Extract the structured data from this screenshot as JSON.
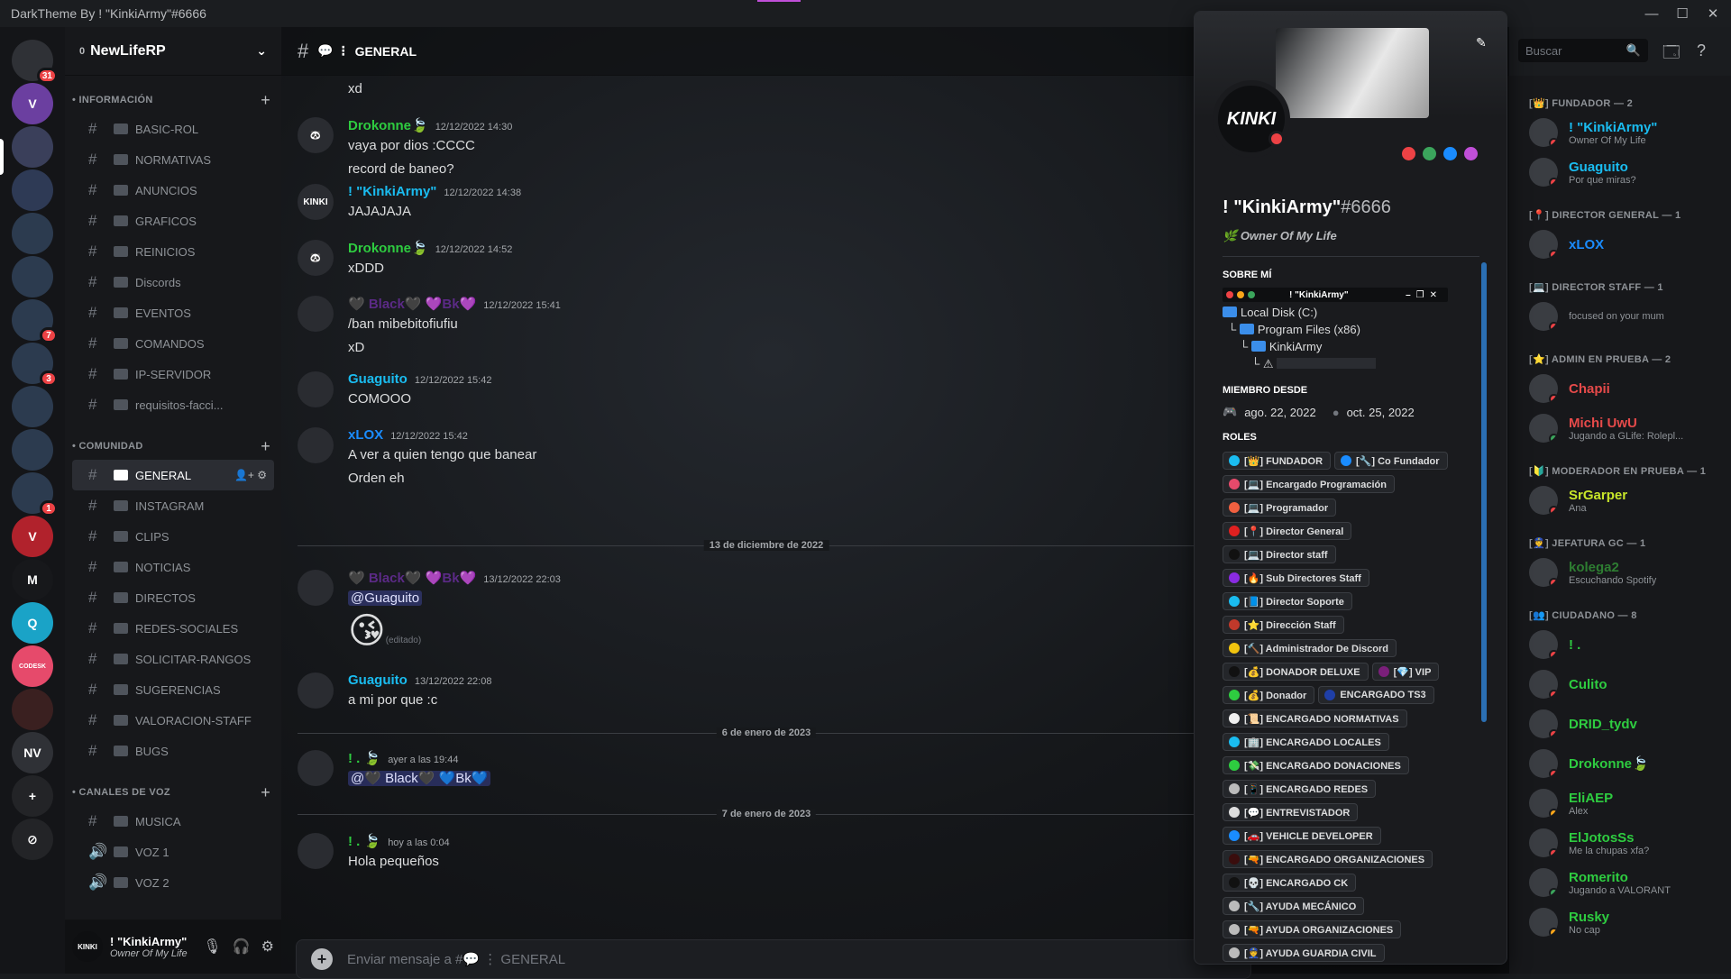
{
  "window": {
    "title": "DarkTheme By ! \"KinkiArmy\"#6666",
    "min": "—",
    "max": "☐",
    "close": "✕"
  },
  "servers": [
    {
      "label": "",
      "color": "#2f3136",
      "badge": "31"
    },
    {
      "label": "V",
      "color": "#6b3fa0",
      "badge": ""
    },
    {
      "label": "",
      "color": "#3a3f5a",
      "badge": ""
    },
    {
      "label": "",
      "color": "#2e3a55",
      "badge": ""
    },
    {
      "label": "",
      "color": "#2c3b4f",
      "badge": ""
    },
    {
      "label": "",
      "color": "#2c3b4f",
      "badge": ""
    },
    {
      "label": "",
      "color": "#2c3b4f",
      "badge": "7"
    },
    {
      "label": "",
      "color": "#2c3b4f",
      "badge": "3"
    },
    {
      "label": "",
      "color": "#2c3b4f",
      "badge": ""
    },
    {
      "label": "",
      "color": "#2c3b4f",
      "badge": ""
    },
    {
      "label": "",
      "color": "#2c3b4f",
      "badge": "1"
    },
    {
      "label": "V",
      "color": "#b1222c",
      "badge": ""
    },
    {
      "label": "M",
      "color": "#17181b",
      "badge": ""
    },
    {
      "label": "Q",
      "color": "#1aa3c7",
      "badge": ""
    },
    {
      "label": "CODESK",
      "color": "#e64a6b",
      "badge": ""
    },
    {
      "label": "",
      "color": "#3a2020",
      "badge": ""
    },
    {
      "label": "NV",
      "color": "#2f3136",
      "badge": ""
    },
    {
      "label": "+",
      "color": "#232427",
      "badge": ""
    },
    {
      "label": "⊘",
      "color": "#232427",
      "badge": ""
    }
  ],
  "guild": {
    "name": "NewLifeRP",
    "boost": "0"
  },
  "categories": {
    "info": "• INFORMACIÓN",
    "community": "• COMUNIDAD",
    "voice": "• CANALES DE VOZ"
  },
  "channels_info": [
    "BASIC-ROL",
    "NORMATIVAS",
    "ANUNCIOS",
    "GRAFICOS",
    "REINICIOS",
    "Discords",
    "EVENTOS",
    "COMANDOS",
    "IP-SERVIDOR",
    "requisitos-facci..."
  ],
  "channels_community": [
    "GENERAL",
    "INSTAGRAM",
    "CLIPS",
    "NOTICIAS",
    "DIRECTOS",
    "REDES-SOCIALES",
    "SOLICITAR-RANGOS",
    "SUGERENCIAS",
    "VALORACION-STAFF",
    "BUGS"
  ],
  "channels_voice": [
    "MUSICA",
    "VOZ 1",
    "VOZ 2"
  ],
  "user_panel": {
    "name": "! \"KinkiArmy\"",
    "status": "Owner Of My Life"
  },
  "chat": {
    "channel": "GENERAL",
    "placeholder": "Enviar mensaje a #💬 ⋮ GENERAL",
    "top_line": "xd",
    "messages": [
      {
        "author": "Drokonne🍃",
        "color": "#2ecc40",
        "time": "12/12/2022 14:30",
        "lines": [
          "vaya por dios :CCCC",
          "record de baneo?"
        ],
        "avatar": "🐼"
      },
      {
        "author": "! \"KinkiArmy\"",
        "color": "#1abcf0",
        "time": "12/12/2022 14:38",
        "lines": [
          "JAJAJAJA"
        ],
        "avatar": "KINKI"
      },
      {
        "author": "Drokonne🍃",
        "color": "#2ecc40",
        "time": "12/12/2022 14:52",
        "lines": [
          "xDDD"
        ],
        "avatar": "🐼"
      },
      {
        "author": "🖤 Black🖤 💜Bk💜",
        "color": "#5b2a86",
        "time": "12/12/2022 15:41",
        "lines": [
          "/ban mibebitofiufiu",
          "xD"
        ],
        "avatar": ""
      },
      {
        "author": "Guaguito",
        "color": "#1abcf0",
        "time": "12/12/2022 15:42",
        "lines": [
          "COMOOO"
        ],
        "avatar": ""
      },
      {
        "author": "xLOX",
        "color": "#1a8cff",
        "time": "12/12/2022 15:42",
        "lines": [
          "A ver a quien tengo que banear",
          "Orden eh"
        ],
        "avatar": ""
      },
      {
        "author": "🖤 Black🖤 💜Bk💜",
        "color": "#5b2a86",
        "time": "13/12/2022 22:03",
        "lines": [
          "@Guaguito"
        ],
        "avatar": "",
        "emoji": "😘",
        "edited": "(editado)"
      },
      {
        "author": "Guaguito",
        "color": "#1abcf0",
        "time": "13/12/2022 22:08",
        "lines": [
          "a mi por que :c"
        ],
        "avatar": ""
      },
      {
        "author": "! . 🍃",
        "color": "#2ecc40",
        "time": "ayer a las 19:44",
        "lines": [
          "@🖤 Black🖤 💙Bk💙"
        ],
        "avatar": ""
      },
      {
        "author": "! . 🍃",
        "color": "#2ecc40",
        "time": "hoy a las 0:04",
        "lines": [
          "Hola pequeños"
        ],
        "avatar": ""
      }
    ],
    "dividers": [
      "13 de diciembre de 2022",
      "6 de enero de 2023",
      "7 de enero de 2023"
    ]
  },
  "search": {
    "placeholder": "Buscar"
  },
  "profile": {
    "name": "! \"KinkiArmy\"",
    "tag": "#6666",
    "status": "Owner Of My Life",
    "about_label": "SOBRE MÍ",
    "terminal_title": "! \"KinkiArmy\"",
    "tree": [
      "Local Disk (C:)",
      "Program Files (x86)",
      "KinkiArmy"
    ],
    "member_since_label": "MIEMBRO DESDE",
    "since_discord": "ago. 22, 2022",
    "since_server": "oct. 25, 2022",
    "roles_label": "ROLES",
    "roles": [
      {
        "name": "[👑] FUNDADOR",
        "color": "#1abcf0"
      },
      {
        "name": "[🔧] Co Fundador",
        "color": "#1a8cff"
      },
      {
        "name": "[💻] Encargado Programación",
        "color": "#e64a6b"
      },
      {
        "name": "[💻] Programador",
        "color": "#f06040"
      },
      {
        "name": "[📍] Director General",
        "color": "#e02020"
      },
      {
        "name": "[💻] Director staff",
        "color": "#111111"
      },
      {
        "name": "[🔥] Sub Directores Staff",
        "color": "#8a2be2"
      },
      {
        "name": "[📘] Director Soporte",
        "color": "#1abcf0"
      },
      {
        "name": "[⭐] Dirección Staff",
        "color": "#c0392b"
      },
      {
        "name": "[🔨] Administrador De Discord",
        "color": "#f1c40f"
      },
      {
        "name": "[💰] DONADOR DELUXE",
        "color": "#111111"
      },
      {
        "name": "[💎] VIP",
        "color": "#7a1f7a"
      },
      {
        "name": "[💰] Donador",
        "color": "#2ecc40"
      },
      {
        "name": "ENCARGADO TS3",
        "color": "#1f3fa8"
      },
      {
        "name": "[📜] ENCARGADO NORMATIVAS",
        "color": "#f0f0f0"
      },
      {
        "name": "[🏢] ENCARGADO LOCALES",
        "color": "#1abcf0"
      },
      {
        "name": "[💸] ENCARGADO DONACIONES",
        "color": "#2ecc40"
      },
      {
        "name": "[📱] ENCARGADO REDES",
        "color": "#bbbbbb"
      },
      {
        "name": "[💬] ENTREVISTADOR",
        "color": "#dddddd"
      },
      {
        "name": "[🚗] VEHICLE DEVELOPER",
        "color": "#1a8cff"
      },
      {
        "name": "[🔫] ENCARGADO ORGANIZACIONES",
        "color": "#3a0d0d"
      },
      {
        "name": "[💀] ENCARGADO CK",
        "color": "#111111"
      },
      {
        "name": "[🔧] AYUDA MECÁNICO",
        "color": "#bbbbbb"
      },
      {
        "name": "[🔫] AYUDA ORGANIZACIONES",
        "color": "#bbbbbb"
      },
      {
        "name": "[👮] AYUDA GUARDIA CIVIL",
        "color": "#bbbbbb"
      }
    ]
  },
  "members": {
    "groups": [
      {
        "title": "[👑] FUNDADOR — 2",
        "members": [
          {
            "name": "! \"KinkiArmy\"",
            "color": "#1abcf0",
            "activity": "Owner Of My Life",
            "status": "#ed4245"
          },
          {
            "name": "Guaguito",
            "color": "#1abcf0",
            "activity": "Por que miras?",
            "status": "#ed4245"
          }
        ]
      },
      {
        "title": "[📍] DIRECTOR GENERAL — 1",
        "members": [
          {
            "name": "xLOX",
            "color": "#1a8cff",
            "activity": "",
            "status": "#ed4245"
          }
        ]
      },
      {
        "title": "[💻] DIRECTOR STAFF — 1",
        "members": [
          {
            "name": "",
            "color": "#dcddde",
            "activity": "focused on your mum",
            "status": "#ed4245"
          }
        ]
      },
      {
        "title": "[⭐] ADMIN EN PRUEBA — 2",
        "members": [
          {
            "name": "Chapii",
            "color": "#e64a4a",
            "activity": "",
            "status": "#ed4245"
          },
          {
            "name": "Michi UwU",
            "color": "#e64a4a",
            "activity": "Jugando a GLife: Rolepl...",
            "status": "#3ba55c"
          }
        ]
      },
      {
        "title": "[🔰] MODERADOR EN PRUEBA — 1",
        "members": [
          {
            "name": "SrGarper",
            "color": "#c8e62a",
            "activity": "Ana",
            "status": "#ed4245"
          }
        ]
      },
      {
        "title": "[👮] JEFATURA GC — 1",
        "members": [
          {
            "name": "kolega2",
            "color": "#2e7d32",
            "activity": "Escuchando Spotify",
            "status": "#ed4245"
          }
        ]
      },
      {
        "title": "[👥] CIUDADANO — 8",
        "members": [
          {
            "name": "! .",
            "color": "#2ecc40",
            "activity": "",
            "status": "#ed4245"
          },
          {
            "name": "Culito",
            "color": "#2ecc40",
            "activity": "",
            "status": "#ed4245"
          },
          {
            "name": "DRID_tydv",
            "color": "#2ecc40",
            "activity": "",
            "status": "#ed4245"
          },
          {
            "name": "Drokonne🍃",
            "color": "#2ecc40",
            "activity": "",
            "status": "#ed4245"
          },
          {
            "name": "EliAEP",
            "color": "#2ecc40",
            "activity": "Alex",
            "status": "#faa61a"
          },
          {
            "name": "ElJotosSs",
            "color": "#2ecc40",
            "activity": "Me la chupas xfa?",
            "status": "#ed4245"
          },
          {
            "name": "Romerito",
            "color": "#2ecc40",
            "activity": "Jugando a VALORANT",
            "status": "#3ba55c"
          },
          {
            "name": "Rusky",
            "color": "#2ecc40",
            "activity": "No cap",
            "status": "#faa61a"
          }
        ]
      }
    ]
  }
}
